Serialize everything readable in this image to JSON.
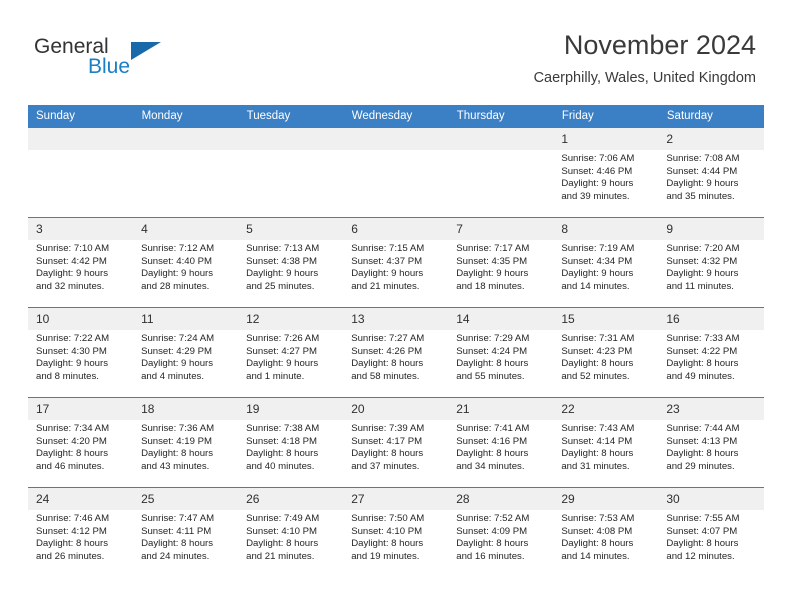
{
  "brand": {
    "name_part1": "General",
    "name_part2": "Blue",
    "accent_color": "#1b7fc4"
  },
  "header": {
    "month_title": "November 2024",
    "location": "Caerphilly, Wales, United Kingdom"
  },
  "calendar": {
    "header_color": "#3b7fc4",
    "weekdays": [
      "Sunday",
      "Monday",
      "Tuesday",
      "Wednesday",
      "Thursday",
      "Friday",
      "Saturday"
    ],
    "weeks": [
      [
        {
          "day": "",
          "lines": []
        },
        {
          "day": "",
          "lines": []
        },
        {
          "day": "",
          "lines": []
        },
        {
          "day": "",
          "lines": []
        },
        {
          "day": "",
          "lines": []
        },
        {
          "day": "1",
          "lines": [
            "Sunrise: 7:06 AM",
            "Sunset: 4:46 PM",
            "Daylight: 9 hours",
            "and 39 minutes."
          ]
        },
        {
          "day": "2",
          "lines": [
            "Sunrise: 7:08 AM",
            "Sunset: 4:44 PM",
            "Daylight: 9 hours",
            "and 35 minutes."
          ]
        }
      ],
      [
        {
          "day": "3",
          "lines": [
            "Sunrise: 7:10 AM",
            "Sunset: 4:42 PM",
            "Daylight: 9 hours",
            "and 32 minutes."
          ]
        },
        {
          "day": "4",
          "lines": [
            "Sunrise: 7:12 AM",
            "Sunset: 4:40 PM",
            "Daylight: 9 hours",
            "and 28 minutes."
          ]
        },
        {
          "day": "5",
          "lines": [
            "Sunrise: 7:13 AM",
            "Sunset: 4:38 PM",
            "Daylight: 9 hours",
            "and 25 minutes."
          ]
        },
        {
          "day": "6",
          "lines": [
            "Sunrise: 7:15 AM",
            "Sunset: 4:37 PM",
            "Daylight: 9 hours",
            "and 21 minutes."
          ]
        },
        {
          "day": "7",
          "lines": [
            "Sunrise: 7:17 AM",
            "Sunset: 4:35 PM",
            "Daylight: 9 hours",
            "and 18 minutes."
          ]
        },
        {
          "day": "8",
          "lines": [
            "Sunrise: 7:19 AM",
            "Sunset: 4:34 PM",
            "Daylight: 9 hours",
            "and 14 minutes."
          ]
        },
        {
          "day": "9",
          "lines": [
            "Sunrise: 7:20 AM",
            "Sunset: 4:32 PM",
            "Daylight: 9 hours",
            "and 11 minutes."
          ]
        }
      ],
      [
        {
          "day": "10",
          "lines": [
            "Sunrise: 7:22 AM",
            "Sunset: 4:30 PM",
            "Daylight: 9 hours",
            "and 8 minutes."
          ]
        },
        {
          "day": "11",
          "lines": [
            "Sunrise: 7:24 AM",
            "Sunset: 4:29 PM",
            "Daylight: 9 hours",
            "and 4 minutes."
          ]
        },
        {
          "day": "12",
          "lines": [
            "Sunrise: 7:26 AM",
            "Sunset: 4:27 PM",
            "Daylight: 9 hours",
            "and 1 minute."
          ]
        },
        {
          "day": "13",
          "lines": [
            "Sunrise: 7:27 AM",
            "Sunset: 4:26 PM",
            "Daylight: 8 hours",
            "and 58 minutes."
          ]
        },
        {
          "day": "14",
          "lines": [
            "Sunrise: 7:29 AM",
            "Sunset: 4:24 PM",
            "Daylight: 8 hours",
            "and 55 minutes."
          ]
        },
        {
          "day": "15",
          "lines": [
            "Sunrise: 7:31 AM",
            "Sunset: 4:23 PM",
            "Daylight: 8 hours",
            "and 52 minutes."
          ]
        },
        {
          "day": "16",
          "lines": [
            "Sunrise: 7:33 AM",
            "Sunset: 4:22 PM",
            "Daylight: 8 hours",
            "and 49 minutes."
          ]
        }
      ],
      [
        {
          "day": "17",
          "lines": [
            "Sunrise: 7:34 AM",
            "Sunset: 4:20 PM",
            "Daylight: 8 hours",
            "and 46 minutes."
          ]
        },
        {
          "day": "18",
          "lines": [
            "Sunrise: 7:36 AM",
            "Sunset: 4:19 PM",
            "Daylight: 8 hours",
            "and 43 minutes."
          ]
        },
        {
          "day": "19",
          "lines": [
            "Sunrise: 7:38 AM",
            "Sunset: 4:18 PM",
            "Daylight: 8 hours",
            "and 40 minutes."
          ]
        },
        {
          "day": "20",
          "lines": [
            "Sunrise: 7:39 AM",
            "Sunset: 4:17 PM",
            "Daylight: 8 hours",
            "and 37 minutes."
          ]
        },
        {
          "day": "21",
          "lines": [
            "Sunrise: 7:41 AM",
            "Sunset: 4:16 PM",
            "Daylight: 8 hours",
            "and 34 minutes."
          ]
        },
        {
          "day": "22",
          "lines": [
            "Sunrise: 7:43 AM",
            "Sunset: 4:14 PM",
            "Daylight: 8 hours",
            "and 31 minutes."
          ]
        },
        {
          "day": "23",
          "lines": [
            "Sunrise: 7:44 AM",
            "Sunset: 4:13 PM",
            "Daylight: 8 hours",
            "and 29 minutes."
          ]
        }
      ],
      [
        {
          "day": "24",
          "lines": [
            "Sunrise: 7:46 AM",
            "Sunset: 4:12 PM",
            "Daylight: 8 hours",
            "and 26 minutes."
          ]
        },
        {
          "day": "25",
          "lines": [
            "Sunrise: 7:47 AM",
            "Sunset: 4:11 PM",
            "Daylight: 8 hours",
            "and 24 minutes."
          ]
        },
        {
          "day": "26",
          "lines": [
            "Sunrise: 7:49 AM",
            "Sunset: 4:10 PM",
            "Daylight: 8 hours",
            "and 21 minutes."
          ]
        },
        {
          "day": "27",
          "lines": [
            "Sunrise: 7:50 AM",
            "Sunset: 4:10 PM",
            "Daylight: 8 hours",
            "and 19 minutes."
          ]
        },
        {
          "day": "28",
          "lines": [
            "Sunrise: 7:52 AM",
            "Sunset: 4:09 PM",
            "Daylight: 8 hours",
            "and 16 minutes."
          ]
        },
        {
          "day": "29",
          "lines": [
            "Sunrise: 7:53 AM",
            "Sunset: 4:08 PM",
            "Daylight: 8 hours",
            "and 14 minutes."
          ]
        },
        {
          "day": "30",
          "lines": [
            "Sunrise: 7:55 AM",
            "Sunset: 4:07 PM",
            "Daylight: 8 hours",
            "and 12 minutes."
          ]
        }
      ]
    ]
  }
}
